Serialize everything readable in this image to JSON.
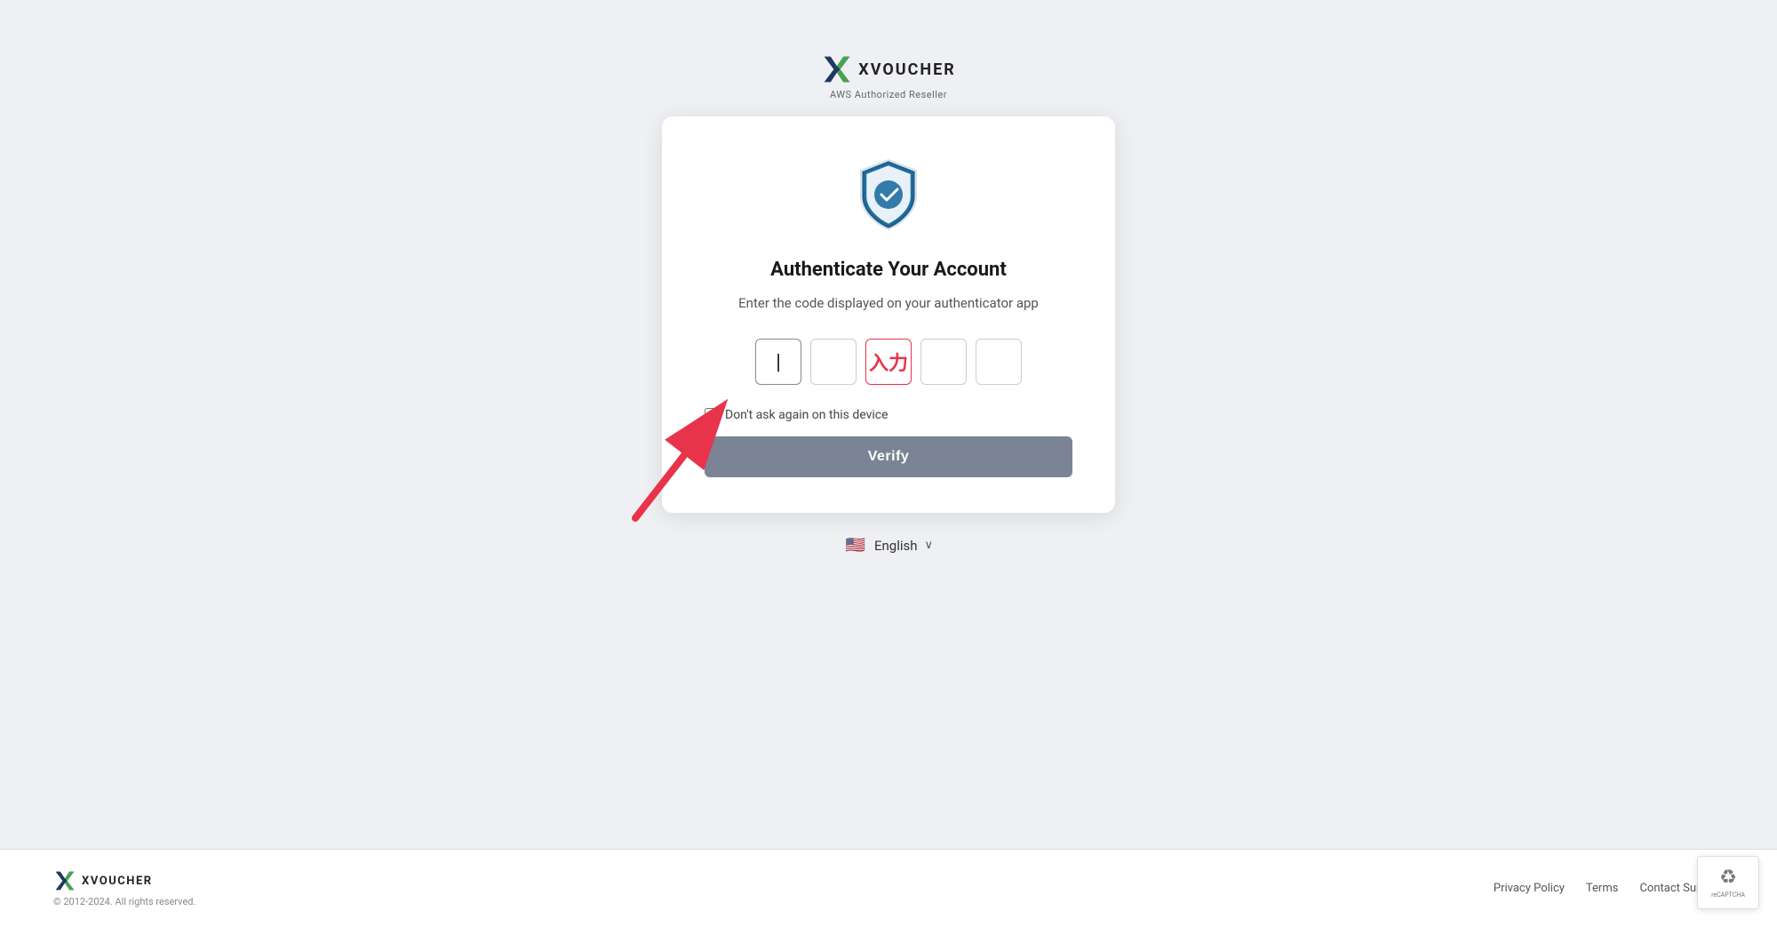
{
  "logo": {
    "brand_name": "XVOUCHER",
    "tagline": "AWS Authorized Reseller"
  },
  "card": {
    "title": "Authenticate Your Account",
    "description": "Enter the code displayed on your authenticator app",
    "otp": {
      "digits": [
        "",
        "",
        "入力",
        "",
        ""
      ],
      "placeholder": ""
    },
    "checkbox_label": "Don't ask again on this device",
    "verify_button": "Verify"
  },
  "language_selector": {
    "language": "English",
    "flag": "🇺🇸"
  },
  "footer": {
    "brand_name": "XVOUCHER",
    "copyright": "© 2012-2024. All rights reserved.",
    "links": [
      {
        "label": "Privacy Policy"
      },
      {
        "label": "Terms"
      },
      {
        "label": "Contact Support"
      }
    ]
  },
  "icons": {
    "chevron_down": "∨",
    "recaptcha_label": "reCAPTCHA"
  }
}
